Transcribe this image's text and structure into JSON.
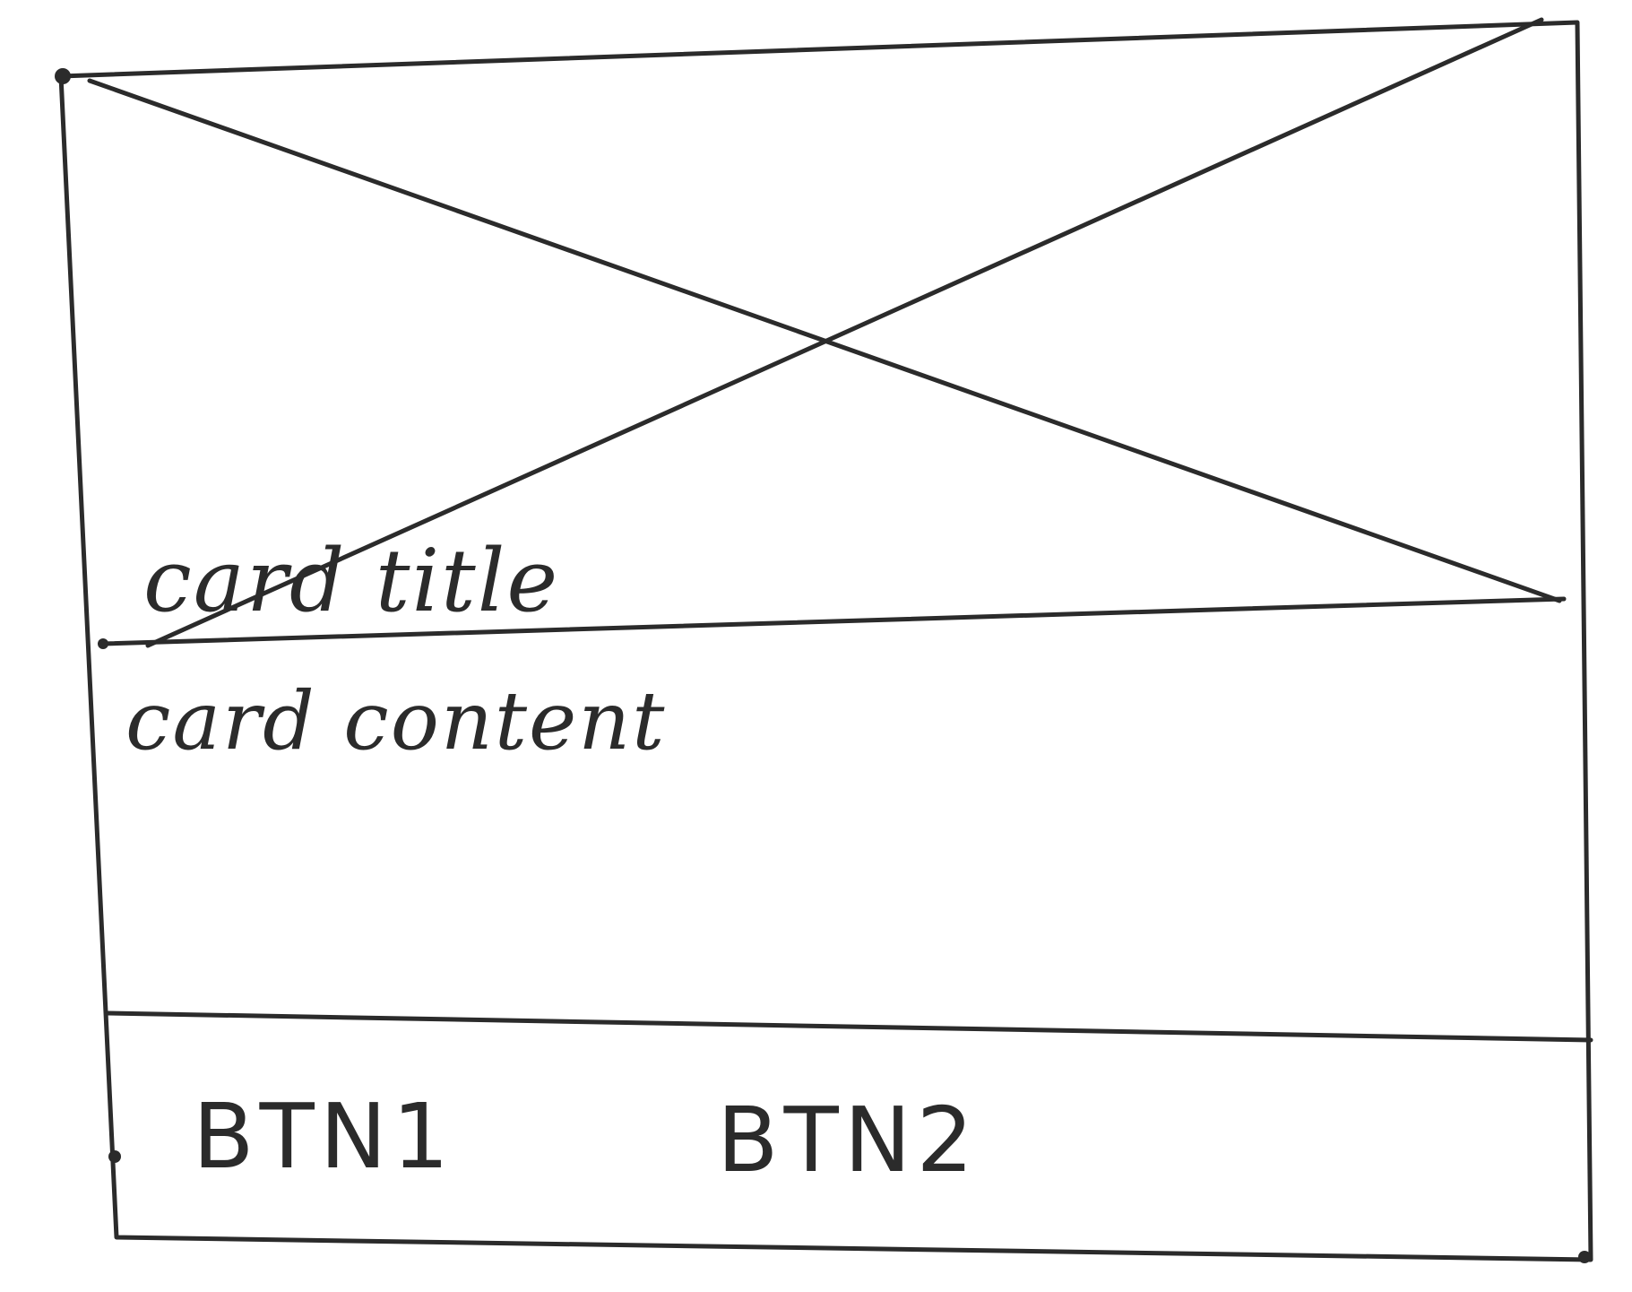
{
  "card": {
    "image_placeholder": "image-placeholder",
    "title": "card title",
    "content": "card content",
    "buttons": [
      {
        "label": "BTN1"
      },
      {
        "label": "BTN2"
      }
    ]
  },
  "colors": {
    "ink": "#2b2b2b",
    "paper": "#ffffff"
  }
}
